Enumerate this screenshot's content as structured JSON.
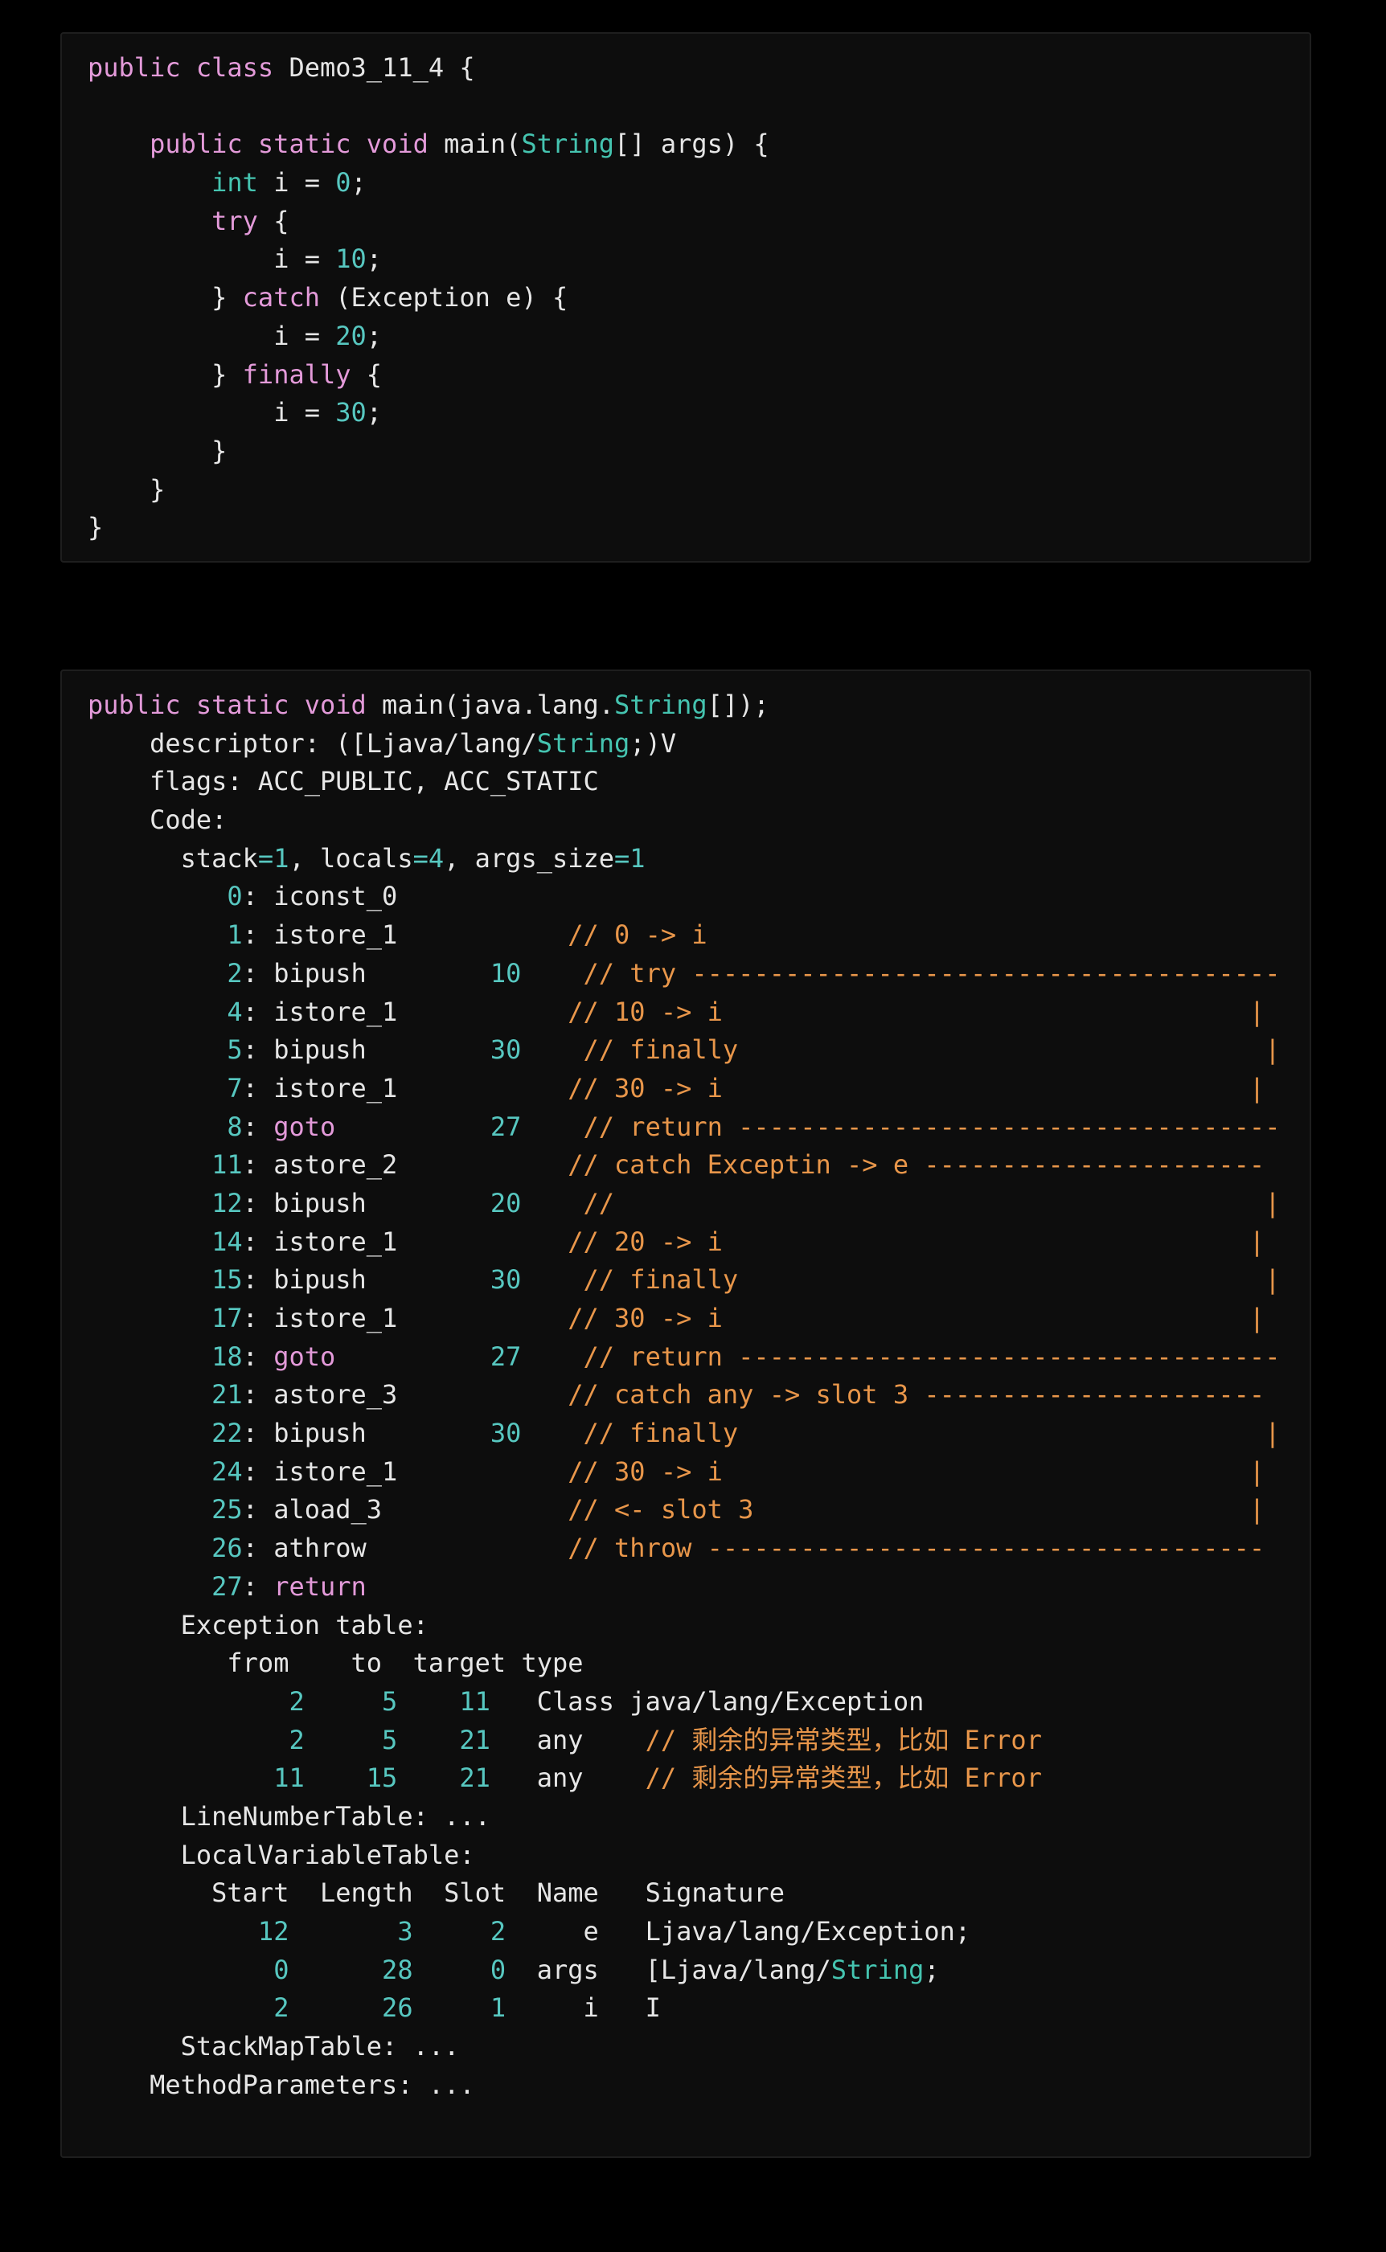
{
  "source_code": {
    "lines": [
      [
        {
          "t": "public class",
          "c": "kw"
        },
        {
          "t": " Demo3_11_4 {",
          "c": "tx"
        }
      ],
      [],
      [
        {
          "t": "    ",
          "c": "tx"
        },
        {
          "t": "public static void",
          "c": "kw"
        },
        {
          "t": " main(",
          "c": "tx"
        },
        {
          "t": "String",
          "c": "ty"
        },
        {
          "t": "[] args) {",
          "c": "tx"
        }
      ],
      [
        {
          "t": "        ",
          "c": "tx"
        },
        {
          "t": "int",
          "c": "ty"
        },
        {
          "t": " i = ",
          "c": "tx"
        },
        {
          "t": "0",
          "c": "num"
        },
        {
          "t": ";",
          "c": "tx"
        }
      ],
      [
        {
          "t": "        ",
          "c": "tx"
        },
        {
          "t": "try",
          "c": "kw"
        },
        {
          "t": " {",
          "c": "tx"
        }
      ],
      [
        {
          "t": "            i = ",
          "c": "tx"
        },
        {
          "t": "10",
          "c": "num"
        },
        {
          "t": ";",
          "c": "tx"
        }
      ],
      [
        {
          "t": "        } ",
          "c": "tx"
        },
        {
          "t": "catch",
          "c": "kw"
        },
        {
          "t": " (Exception e) {",
          "c": "tx"
        }
      ],
      [
        {
          "t": "            i = ",
          "c": "tx"
        },
        {
          "t": "20",
          "c": "num"
        },
        {
          "t": ";",
          "c": "tx"
        }
      ],
      [
        {
          "t": "        } ",
          "c": "tx"
        },
        {
          "t": "finally",
          "c": "kw"
        },
        {
          "t": " {",
          "c": "tx"
        }
      ],
      [
        {
          "t": "            i = ",
          "c": "tx"
        },
        {
          "t": "30",
          "c": "num"
        },
        {
          "t": ";",
          "c": "tx"
        }
      ],
      [
        {
          "t": "        }",
          "c": "tx"
        }
      ],
      [
        {
          "t": "    }",
          "c": "tx"
        }
      ],
      [
        {
          "t": "}",
          "c": "tx"
        }
      ]
    ]
  },
  "bytecode": {
    "lines": [
      [
        {
          "t": "public static void",
          "c": "kw"
        },
        {
          "t": " main(java.lang.",
          "c": "tx"
        },
        {
          "t": "String",
          "c": "ty"
        },
        {
          "t": "[]);",
          "c": "tx"
        }
      ],
      [
        {
          "t": "    descriptor: ([Ljava/lang/",
          "c": "tx"
        },
        {
          "t": "String",
          "c": "ty"
        },
        {
          "t": ";)V",
          "c": "tx"
        }
      ],
      [
        {
          "t": "    flags: ACC_PUBLIC, ACC_STATIC",
          "c": "tx"
        }
      ],
      [
        {
          "t": "    Code:",
          "c": "tx"
        }
      ],
      [
        {
          "t": "      stack",
          "c": "tx"
        },
        {
          "t": "=1",
          "c": "num"
        },
        {
          "t": ", locals",
          "c": "tx"
        },
        {
          "t": "=4",
          "c": "num"
        },
        {
          "t": ", args_size",
          "c": "tx"
        },
        {
          "t": "=1",
          "c": "num"
        }
      ],
      [
        {
          "t": "         0",
          "c": "num"
        },
        {
          "t": ": iconst_0",
          "c": "tx"
        }
      ],
      [
        {
          "t": "         1",
          "c": "num"
        },
        {
          "t": ": istore_1           ",
          "c": "tx"
        },
        {
          "t": "// 0 -> i",
          "c": "cm"
        }
      ],
      [
        {
          "t": "         2",
          "c": "num"
        },
        {
          "t": ": bipush        ",
          "c": "tx"
        },
        {
          "t": "10",
          "c": "num"
        },
        {
          "t": "    ",
          "c": "tx"
        },
        {
          "t": "// try --------------------------------------",
          "c": "cm"
        }
      ],
      [
        {
          "t": "         4",
          "c": "num"
        },
        {
          "t": ": istore_1           ",
          "c": "tx"
        },
        {
          "t": "// 10 -> i                                  |",
          "c": "cm"
        }
      ],
      [
        {
          "t": "         5",
          "c": "num"
        },
        {
          "t": ": bipush        ",
          "c": "tx"
        },
        {
          "t": "30",
          "c": "num"
        },
        {
          "t": "    ",
          "c": "tx"
        },
        {
          "t": "// finally                                  |",
          "c": "cm"
        }
      ],
      [
        {
          "t": "         7",
          "c": "num"
        },
        {
          "t": ": istore_1           ",
          "c": "tx"
        },
        {
          "t": "// 30 -> i                                  |",
          "c": "cm"
        }
      ],
      [
        {
          "t": "         8",
          "c": "num"
        },
        {
          "t": ": ",
          "c": "tx"
        },
        {
          "t": "goto",
          "c": "kw"
        },
        {
          "t": "          ",
          "c": "tx"
        },
        {
          "t": "27",
          "c": "num"
        },
        {
          "t": "    ",
          "c": "tx"
        },
        {
          "t": "// return -----------------------------------",
          "c": "cm"
        }
      ],
      [
        {
          "t": "        11",
          "c": "num"
        },
        {
          "t": ": astore_2           ",
          "c": "tx"
        },
        {
          "t": "// catch Exceptin -> e ----------------------",
          "c": "cm"
        }
      ],
      [
        {
          "t": "        12",
          "c": "num"
        },
        {
          "t": ": bipush        ",
          "c": "tx"
        },
        {
          "t": "20",
          "c": "num"
        },
        {
          "t": "    ",
          "c": "tx"
        },
        {
          "t": "//                                          |",
          "c": "cm"
        }
      ],
      [
        {
          "t": "        14",
          "c": "num"
        },
        {
          "t": ": istore_1           ",
          "c": "tx"
        },
        {
          "t": "// 20 -> i                                  |",
          "c": "cm"
        }
      ],
      [
        {
          "t": "        15",
          "c": "num"
        },
        {
          "t": ": bipush        ",
          "c": "tx"
        },
        {
          "t": "30",
          "c": "num"
        },
        {
          "t": "    ",
          "c": "tx"
        },
        {
          "t": "// finally                                  |",
          "c": "cm"
        }
      ],
      [
        {
          "t": "        17",
          "c": "num"
        },
        {
          "t": ": istore_1           ",
          "c": "tx"
        },
        {
          "t": "// 30 -> i                                  |",
          "c": "cm"
        }
      ],
      [
        {
          "t": "        18",
          "c": "num"
        },
        {
          "t": ": ",
          "c": "tx"
        },
        {
          "t": "goto",
          "c": "kw"
        },
        {
          "t": "          ",
          "c": "tx"
        },
        {
          "t": "27",
          "c": "num"
        },
        {
          "t": "    ",
          "c": "tx"
        },
        {
          "t": "// return -----------------------------------",
          "c": "cm"
        }
      ],
      [
        {
          "t": "        21",
          "c": "num"
        },
        {
          "t": ": astore_3           ",
          "c": "tx"
        },
        {
          "t": "// catch any -> slot 3 ----------------------",
          "c": "cm"
        }
      ],
      [
        {
          "t": "        22",
          "c": "num"
        },
        {
          "t": ": bipush        ",
          "c": "tx"
        },
        {
          "t": "30",
          "c": "num"
        },
        {
          "t": "    ",
          "c": "tx"
        },
        {
          "t": "// finally                                  |",
          "c": "cm"
        }
      ],
      [
        {
          "t": "        24",
          "c": "num"
        },
        {
          "t": ": istore_1           ",
          "c": "tx"
        },
        {
          "t": "// 30 -> i                                  |",
          "c": "cm"
        }
      ],
      [
        {
          "t": "        25",
          "c": "num"
        },
        {
          "t": ": aload_3            ",
          "c": "tx"
        },
        {
          "t": "// <- slot 3                                |",
          "c": "cm"
        }
      ],
      [
        {
          "t": "        26",
          "c": "num"
        },
        {
          "t": ": athrow             ",
          "c": "tx"
        },
        {
          "t": "// throw ------------------------------------",
          "c": "cm"
        }
      ],
      [
        {
          "t": "        27",
          "c": "num"
        },
        {
          "t": ": ",
          "c": "tx"
        },
        {
          "t": "return",
          "c": "kw"
        }
      ],
      [
        {
          "t": "      Exception table:",
          "c": "tx"
        }
      ],
      [
        {
          "t": "         from    to  target type",
          "c": "tx"
        }
      ],
      [
        {
          "t": "             ",
          "c": "tx"
        },
        {
          "t": "2",
          "c": "num"
        },
        {
          "t": "     ",
          "c": "tx"
        },
        {
          "t": "5",
          "c": "num"
        },
        {
          "t": "    ",
          "c": "tx"
        },
        {
          "t": "11",
          "c": "num"
        },
        {
          "t": "   Class java/lang/Exception",
          "c": "tx"
        }
      ],
      [
        {
          "t": "             ",
          "c": "tx"
        },
        {
          "t": "2",
          "c": "num"
        },
        {
          "t": "     ",
          "c": "tx"
        },
        {
          "t": "5",
          "c": "num"
        },
        {
          "t": "    ",
          "c": "tx"
        },
        {
          "t": "21",
          "c": "num"
        },
        {
          "t": "   any    ",
          "c": "tx"
        },
        {
          "t": "// 剩余的异常类型，比如 Error",
          "c": "cm"
        }
      ],
      [
        {
          "t": "            ",
          "c": "tx"
        },
        {
          "t": "11",
          "c": "num"
        },
        {
          "t": "    ",
          "c": "tx"
        },
        {
          "t": "15",
          "c": "num"
        },
        {
          "t": "    ",
          "c": "tx"
        },
        {
          "t": "21",
          "c": "num"
        },
        {
          "t": "   any    ",
          "c": "tx"
        },
        {
          "t": "// 剩余的异常类型，比如 Error",
          "c": "cm"
        }
      ],
      [
        {
          "t": "      LineNumberTable: ...",
          "c": "tx"
        }
      ],
      [
        {
          "t": "      LocalVariableTable:",
          "c": "tx"
        }
      ],
      [
        {
          "t": "        Start  Length  Slot  Name   Signature",
          "c": "tx"
        }
      ],
      [
        {
          "t": "           ",
          "c": "tx"
        },
        {
          "t": "12",
          "c": "num"
        },
        {
          "t": "       ",
          "c": "tx"
        },
        {
          "t": "3",
          "c": "num"
        },
        {
          "t": "     ",
          "c": "tx"
        },
        {
          "t": "2",
          "c": "num"
        },
        {
          "t": "     e   Ljava/lang/Exception;",
          "c": "tx"
        }
      ],
      [
        {
          "t": "            ",
          "c": "tx"
        },
        {
          "t": "0",
          "c": "num"
        },
        {
          "t": "      ",
          "c": "tx"
        },
        {
          "t": "28",
          "c": "num"
        },
        {
          "t": "     ",
          "c": "tx"
        },
        {
          "t": "0",
          "c": "num"
        },
        {
          "t": "  args   [Ljava/lang/",
          "c": "tx"
        },
        {
          "t": "String",
          "c": "ty"
        },
        {
          "t": ";",
          "c": "tx"
        }
      ],
      [
        {
          "t": "            ",
          "c": "tx"
        },
        {
          "t": "2",
          "c": "num"
        },
        {
          "t": "      ",
          "c": "tx"
        },
        {
          "t": "26",
          "c": "num"
        },
        {
          "t": "     ",
          "c": "tx"
        },
        {
          "t": "1",
          "c": "num"
        },
        {
          "t": "     i   I",
          "c": "tx"
        }
      ],
      [
        {
          "t": "      StackMapTable: ...",
          "c": "tx"
        }
      ],
      [
        {
          "t": "    MethodParameters: ...",
          "c": "tx"
        }
      ]
    ]
  }
}
